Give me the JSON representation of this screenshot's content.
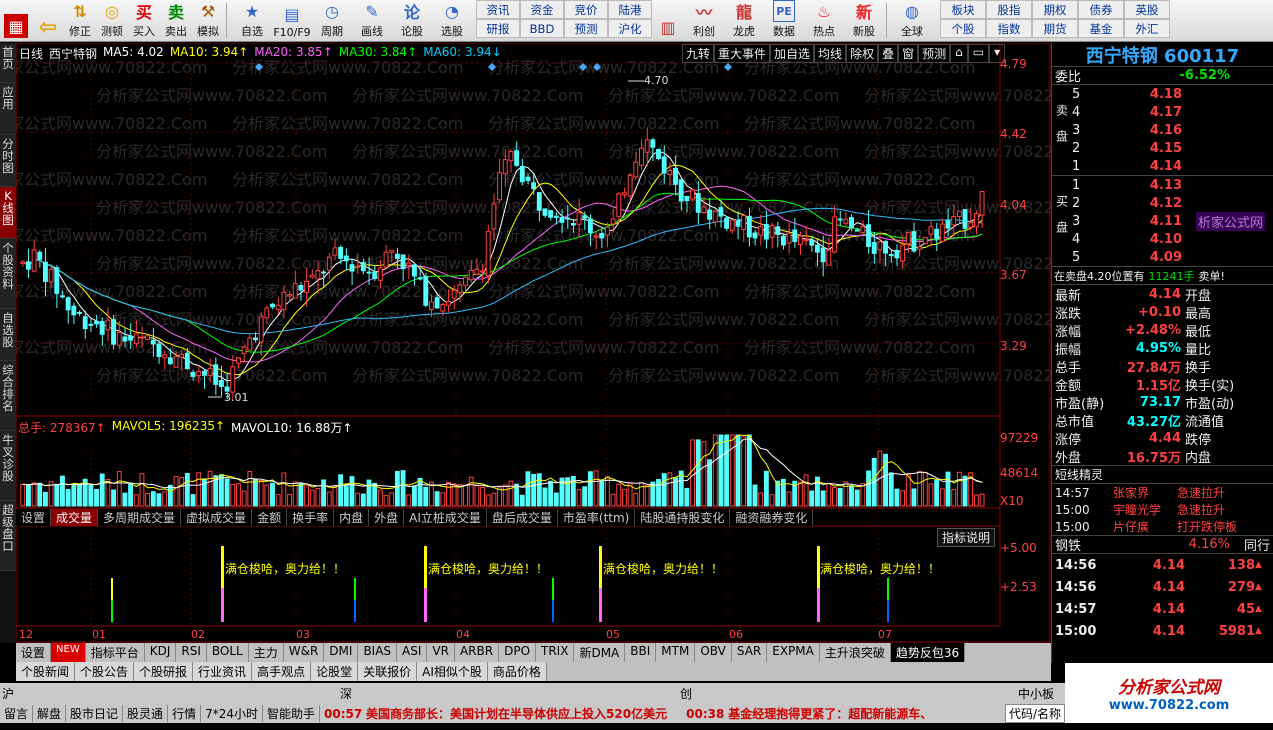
{
  "toolbar": {
    "buttons": [
      "",
      "",
      "修正",
      "测顿",
      "买入",
      "卖出",
      "模拟",
      "自选",
      "F10/F9",
      "周期",
      "画线",
      "论股",
      "选股",
      "",
      "",
      "",
      "利创",
      "龙虎",
      "数据",
      "热点",
      "新股",
      "全球"
    ],
    "grid_a": [
      "资讯",
      "资金",
      "竞价",
      "研报",
      "BBD",
      "预测"
    ],
    "grid_b": [
      "陆港",
      "沪化"
    ],
    "grid_c": [
      "板块",
      "股指",
      "期权",
      "债券",
      "英股",
      "个股",
      "指数",
      "期货",
      "基金",
      "外汇"
    ]
  },
  "left_tabs": [
    "首页",
    "应用",
    "分时图",
    "K线图",
    "个股资料",
    "自选股",
    "综合排名",
    "牛叉诊股",
    "超级盘口"
  ],
  "chart": {
    "period": "日线",
    "stock_name": "西宁特钢",
    "ma_labels": [
      {
        "text": "MA5: 4.02",
        "color": "#ffffff"
      },
      {
        "text": "MA10: 3.94↑",
        "color": "#ffff00"
      },
      {
        "text": "MA20: 3.85↑",
        "color": "#ff66ff"
      },
      {
        "text": "MA30: 3.84↑",
        "color": "#00ff00"
      },
      {
        "text": "MA60: 3.94↓",
        "color": "#00ccff"
      }
    ],
    "top_buttons": [
      "九转",
      "重大事件",
      "加自选",
      "均线",
      "除权",
      "叠",
      "窗",
      "预测"
    ],
    "price_ticks": [
      "4.79",
      "4.42",
      "4.04",
      "3.67",
      "3.29"
    ],
    "high_label": "4.70",
    "low_label": "3.01",
    "watermark": "分析家公式网www.70822.Com",
    "chart_data": {
      "type": "candlestick",
      "xlabel": "",
      "ylabel": "",
      "ylim": [
        3.0,
        4.79
      ],
      "x_ticks": [
        "12",
        "01",
        "02",
        "03",
        "04",
        "05",
        "06",
        "07"
      ],
      "key_points": [
        {
          "label": "low",
          "value": 3.01
        },
        {
          "label": "high",
          "value": 4.7
        },
        {
          "label": "last",
          "value": 4.14
        }
      ]
    }
  },
  "volume": {
    "header": [
      {
        "text": "总手: 278367↑",
        "color": "#ff4040"
      },
      {
        "text": "MAVOL5: 196235↑",
        "color": "#ffff00"
      },
      {
        "text": "MAVOL10: 16.88万↑",
        "color": "#ffffff"
      }
    ],
    "ticks": [
      "97229",
      "48614",
      "X10"
    ]
  },
  "indicator_tabs": [
    "设置",
    "成交量",
    "多周期成交量",
    "虚拟成交量",
    "金额",
    "换手率",
    "内盘",
    "外盘",
    "AI立桩成交量",
    "盘后成交量",
    "市盈率(ttm)",
    "陆股通持股变化",
    "融资融券变化"
  ],
  "indicator": {
    "button": "指标说明",
    "ticks": [
      "+5.00",
      "+2.53"
    ],
    "signal_text": "满仓梭哈，奥力给！！"
  },
  "x_axis": [
    "12",
    "01",
    "02",
    "03",
    "04",
    "05",
    "06",
    "07"
  ],
  "bottom_tabs": [
    "设置",
    "NEW",
    "指标平台",
    "KDJ",
    "RSI",
    "BOLL",
    "主力",
    "W&R",
    "DMI",
    "BIAS",
    "ASI",
    "VR",
    "ARBR",
    "DPO",
    "TRIX",
    "新DMA",
    "BBI",
    "MTM",
    "OBV",
    "SAR",
    "EXPMA",
    "主升浪突破",
    "趋势反包36"
  ],
  "news_tabs": [
    "个股新闻",
    "个股公告",
    "个股研报",
    "行业资讯",
    "高手观点",
    "论股堂",
    "关联报价",
    "AI相似个股",
    "商品价格"
  ],
  "market_bar": {
    "sh": "沪",
    "sz": "深",
    "cy": "创",
    "zxb": "中小板"
  },
  "status_bar": {
    "labels": [
      "留言",
      "解盘",
      "股市日记",
      "股灵通",
      "行情",
      "7*24小时",
      "智能助手"
    ],
    "news1_time": "00:57",
    "news1": "美国商务部长：美国计划在半导体供应上投入520亿美元",
    "news2_time": "00:38",
    "news2": "基金经理抱得更紧了：超配新能源车、",
    "code": "代码/名称"
  },
  "right_panel": {
    "title": "西宁特钢 600117",
    "weibi_label": "委比",
    "weibi": "-6.52%",
    "sell_label": "卖盘",
    "buy_label": "买盘",
    "sells": [
      {
        "lvl": "5",
        "price": "4.18"
      },
      {
        "lvl": "4",
        "price": "4.17"
      },
      {
        "lvl": "3",
        "price": "4.16"
      },
      {
        "lvl": "2",
        "price": "4.15"
      },
      {
        "lvl": "1",
        "price": "4.14"
      }
    ],
    "buys": [
      {
        "lvl": "1",
        "price": "4.13"
      },
      {
        "lvl": "2",
        "price": "4.12"
      },
      {
        "lvl": "3",
        "price": "4.11",
        "note": "析家公式网"
      },
      {
        "lvl": "4",
        "price": "4.10"
      },
      {
        "lvl": "5",
        "price": "4.09"
      }
    ],
    "big_order": "在卖盘4.20位置有",
    "big_order_hands": "11241手",
    "big_order_tag": "卖单!",
    "quote_rows": [
      {
        "l": "最新",
        "v": "4.14",
        "r": "开盘"
      },
      {
        "l": "涨跌",
        "v": "+0.10",
        "r": "最高"
      },
      {
        "l": "涨幅",
        "v": "+2.48%",
        "r": "最低"
      },
      {
        "l": "振幅",
        "v": "4.95%",
        "r": "量比"
      },
      {
        "l": "总手",
        "v": "27.84万",
        "r": "换手"
      },
      {
        "l": "金额",
        "v": "1.15亿",
        "r": "换手(实)"
      },
      {
        "l": "市盈(静)",
        "v": "73.17",
        "r": "市盈(动)"
      },
      {
        "l": "总市值",
        "v": "43.27亿",
        "r": "流通值"
      },
      {
        "l": "涨停",
        "v": "4.44",
        "r": "跌停"
      },
      {
        "l": "外盘",
        "v": "16.75万",
        "r": "内盘"
      }
    ],
    "spirit_title": "短线精灵",
    "spirits": [
      {
        "time": "14:57",
        "name": "张家界",
        "tag": "急速拉升"
      },
      {
        "time": "15:00",
        "name": "宇瞳光学",
        "tag": "急速拉升"
      },
      {
        "time": "15:00",
        "name": "片仔癀",
        "tag": "打开跌停板"
      }
    ],
    "sector": "钢铁",
    "sector_pct": "4.16%",
    "sector_tail": "同行",
    "ticks": [
      {
        "time": "14:56",
        "price": "4.14",
        "vol": "138"
      },
      {
        "time": "14:56",
        "price": "4.14",
        "vol": "279"
      },
      {
        "time": "14:57",
        "price": "4.14",
        "vol": "45"
      },
      {
        "time": "15:00",
        "price": "4.14",
        "vol": "5981"
      }
    ]
  },
  "logo": {
    "name": "分析家公式网",
    "url": "www.70822.com"
  },
  "colors": {
    "up": "#ff4040",
    "down": "#00ffff",
    "bg": "#000000"
  }
}
